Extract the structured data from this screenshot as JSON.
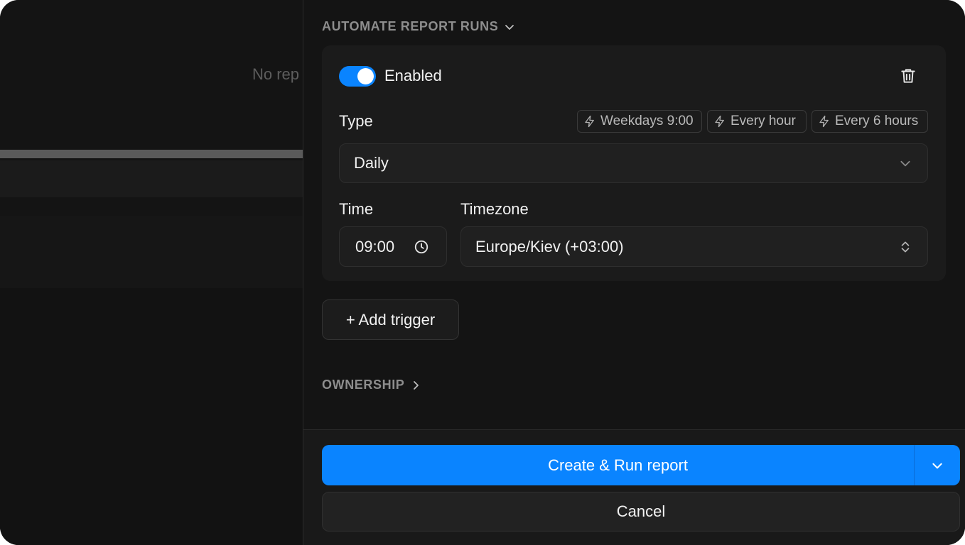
{
  "background": {
    "empty_text": "No rep"
  },
  "automate": {
    "header": "AUTOMATE REPORT RUNS",
    "enabled": true,
    "enabled_label": "Enabled",
    "type_label": "Type",
    "presets": [
      "Weekdays 9:00",
      "Every hour",
      "Every 6 hours"
    ],
    "type_value": "Daily",
    "time_label": "Time",
    "time_value": "09:00",
    "timezone_label": "Timezone",
    "timezone_value": "Europe/Kiev (+03:00)",
    "add_trigger_label": "+ Add trigger"
  },
  "ownership": {
    "header": "OWNERSHIP"
  },
  "footer": {
    "primary_label": "Create & Run report",
    "cancel_label": "Cancel"
  },
  "colors": {
    "accent": "#0a84ff",
    "background": "#141414"
  }
}
